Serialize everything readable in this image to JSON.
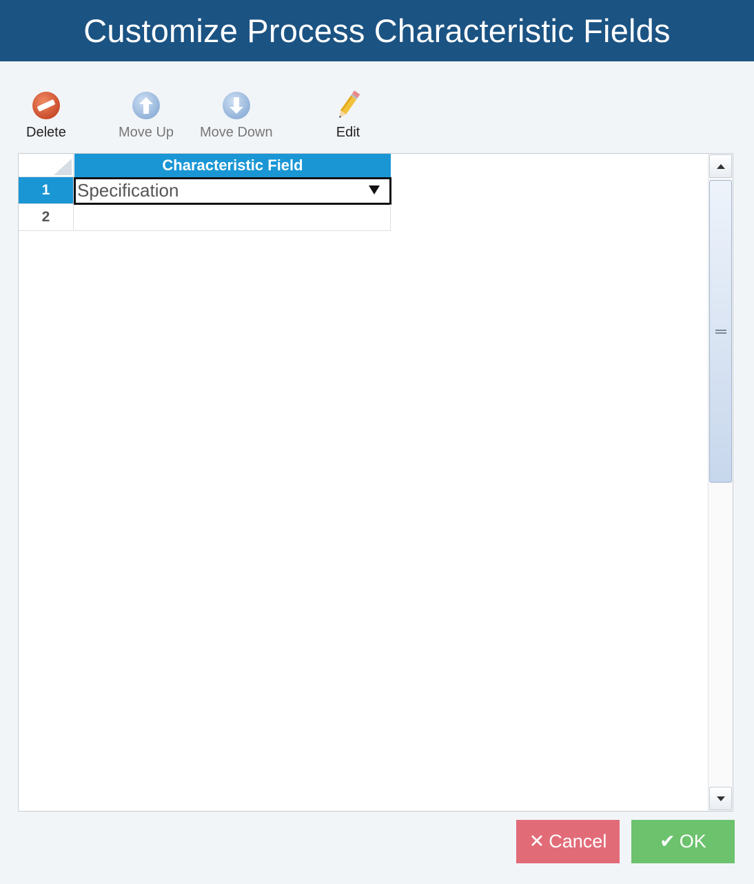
{
  "dialog": {
    "title": "Customize Process Characteristic Fields"
  },
  "toolbar": {
    "delete_label": "Delete",
    "move_up_label": "Move Up",
    "move_down_label": "Move Down",
    "edit_label": "Edit"
  },
  "grid": {
    "columns": [
      "Characteristic Field"
    ],
    "rows": [
      {
        "number": "1",
        "value": "Specification",
        "selected": true
      },
      {
        "number": "2",
        "value": ""
      }
    ]
  },
  "footer": {
    "cancel_label": "Cancel",
    "ok_label": "OK"
  },
  "icons": {
    "delete": "delete-icon",
    "move_up": "arrow-up-icon",
    "move_down": "arrow-down-icon",
    "edit": "pencil-icon",
    "cancel": "x-icon",
    "ok": "check-icon"
  },
  "colors": {
    "title_bar": "#1b5383",
    "header_accent": "#1a96d5",
    "cancel": "#e26b78",
    "ok": "#6cc26d"
  }
}
